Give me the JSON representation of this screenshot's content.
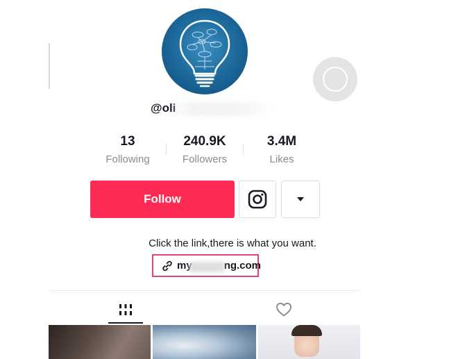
{
  "profile": {
    "username": "@oli",
    "username_obscured": true
  },
  "stats": [
    {
      "value": "13",
      "label": "Following"
    },
    {
      "value": "240.9K",
      "label": "Followers"
    },
    {
      "value": "3.4M",
      "label": "Likes"
    }
  ],
  "actions": {
    "follow_label": "Follow",
    "instagram_icon": "instagram-icon",
    "more_icon": "caret-down-icon"
  },
  "bio": {
    "text": "Click the link,there is what you want.",
    "link_prefix": "my",
    "link_suffix": "ng.com",
    "link_highlight_color": "#e0427f"
  },
  "tabs": [
    {
      "icon": "videos-grid-icon",
      "active": true
    },
    {
      "icon": "heart-icon",
      "active": false
    }
  ],
  "colors": {
    "follow_button": "#fe2c55",
    "text_primary": "#161823",
    "text_secondary": "#8a8b91"
  }
}
